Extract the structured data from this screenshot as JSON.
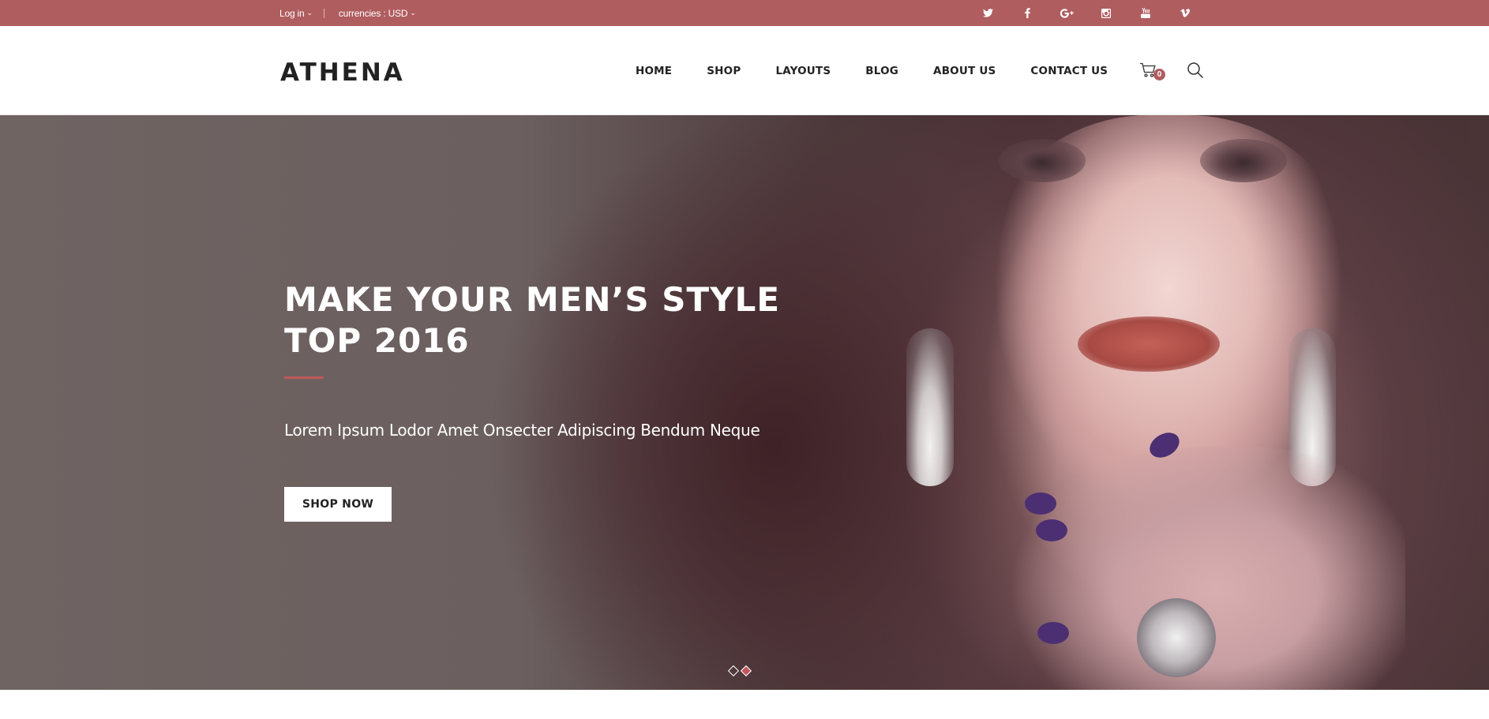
{
  "topbar": {
    "login_label": "Log in",
    "currency_label": "currencies : USD",
    "social": [
      "twitter-icon",
      "facebook-icon",
      "google-plus-icon",
      "instagram-icon",
      "youtube-icon",
      "vimeo-icon"
    ]
  },
  "header": {
    "logo": "ATHENA",
    "nav": [
      "HOME",
      "SHOP",
      "LAYOUTS",
      "BLOG",
      "ABOUT US",
      "CONTACT US"
    ],
    "cart_count": "0"
  },
  "hero": {
    "title_line1": "MAKE YOUR MEN’S STYLE",
    "title_line2": "TOP 2016",
    "subtitle": "Lorem Ipsum Lodor Amet Onsecter Adipiscing Bendum Neque",
    "button": "SHOP NOW",
    "slides": 2,
    "active_slide": 2
  },
  "colors": {
    "accent": "#b05d5f",
    "highlight": "#c0575a"
  }
}
